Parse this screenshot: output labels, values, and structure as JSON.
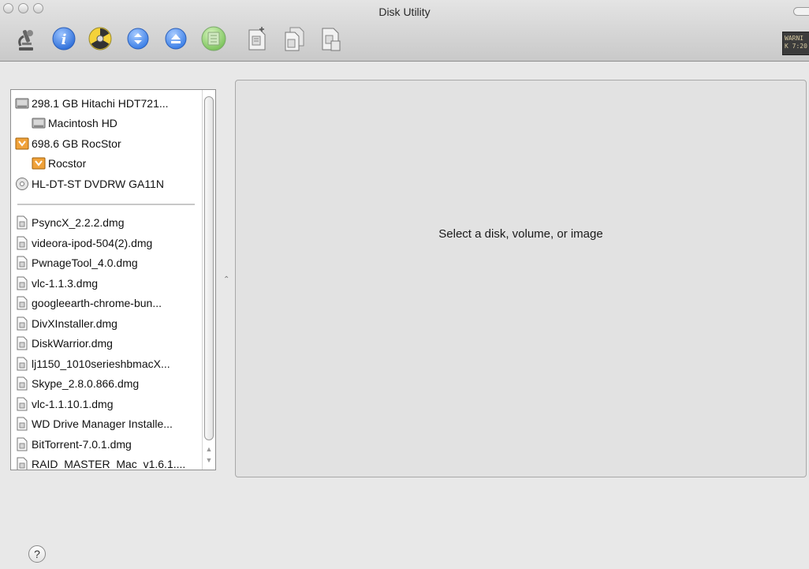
{
  "window": {
    "title": "Disk Utility"
  },
  "toolbar": {
    "icons": [
      "microscope-icon",
      "info-icon",
      "burn-icon",
      "mount-icon",
      "eject-icon",
      "enable-journaling-icon",
      "new-image-icon",
      "convert-icon",
      "resize-image-icon"
    ],
    "log_text": "WARNI\nK 7:20"
  },
  "sidebar": {
    "disks": [
      {
        "label": "298.1 GB Hitachi HDT721...",
        "icon": "hard-disk-icon",
        "indent": false
      },
      {
        "label": "Macintosh HD",
        "icon": "hard-disk-icon",
        "indent": true
      },
      {
        "label": "698.6 GB RocStor",
        "icon": "external-disk-icon",
        "indent": false
      },
      {
        "label": "Rocstor",
        "icon": "external-disk-icon",
        "indent": true
      },
      {
        "label": "HL-DT-ST DVDRW GA11N",
        "icon": "optical-drive-icon",
        "indent": false
      }
    ],
    "images": [
      "PsyncX_2.2.2.dmg",
      "videora-ipod-504(2).dmg",
      "PwnageTool_4.0.dmg",
      "vlc-1.1.3.dmg",
      "googleearth-chrome-bun...",
      "DivXInstaller.dmg",
      "DiskWarrior.dmg",
      "lj1150_1010serieshbmacX...",
      "Skype_2.8.0.866.dmg",
      "vlc-1.1.10.1.dmg",
      "WD Drive Manager Installe...",
      "BitTorrent-7.0.1.dmg",
      "RAID_MASTER_Mac_v1.6.1...."
    ]
  },
  "detail": {
    "message": "Select a disk, volume, or image"
  },
  "help": {
    "label": "?"
  },
  "colors": {
    "window_bg": "#e8e8e8",
    "panel_bg": "#e2e2e2",
    "list_bg": "#ffffff"
  }
}
